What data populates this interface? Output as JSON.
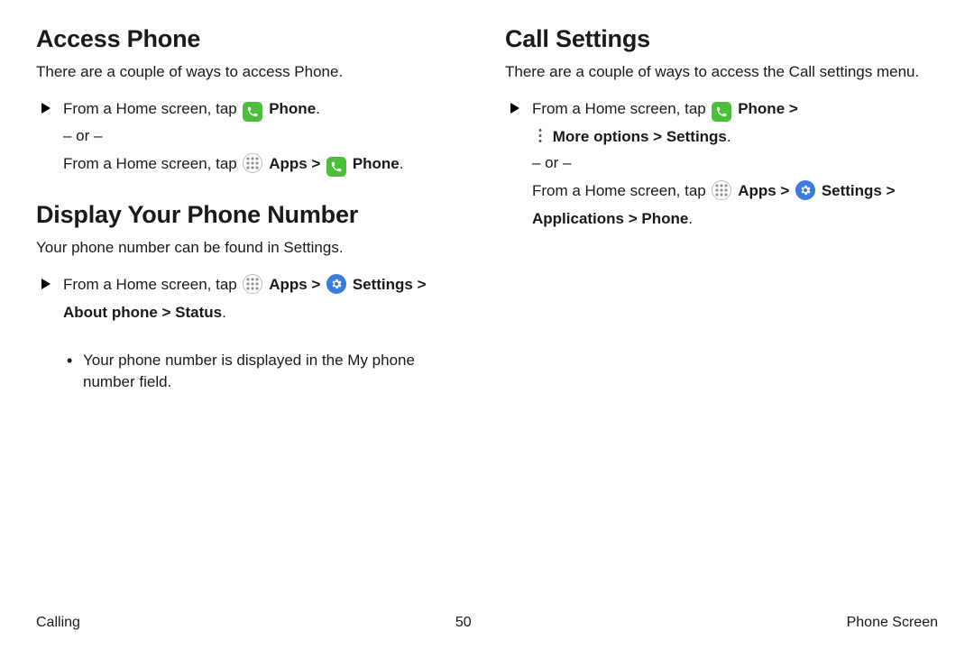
{
  "left": {
    "section1": {
      "heading": "Access Phone",
      "intro": "There are a couple of ways to access Phone.",
      "line1_pre": "From a Home screen, tap ",
      "phone_label": "Phone",
      "or": "– or –",
      "line2_pre": "From a Home screen, tap ",
      "apps_label": "Apps",
      "sep": " > ",
      "phone_label2": "Phone"
    },
    "section2": {
      "heading": "Display Your Phone Number",
      "intro": "Your phone number can be found in Settings.",
      "line1_pre": "From a Home screen, tap ",
      "apps_label": "Apps",
      "sep1": " > ",
      "settings_label": "Settings",
      "sep2": " > ",
      "path_rest": "About phone > Status",
      "bullet": "Your phone number is displayed in the My phone number field."
    }
  },
  "right": {
    "section1": {
      "heading": "Call Settings",
      "intro": "There are a couple of ways to access the Call settings menu.",
      "line1_pre": "From a Home screen, tap ",
      "phone_label": "Phone",
      "sep1": " > ",
      "more_path": "More options > Settings",
      "or": "– or –",
      "line2_pre": "From a Home screen, tap ",
      "apps_label": "Apps",
      "sep2": " > ",
      "settings_label": "Settings",
      "sep3": " > ",
      "path_rest": "Applications > Phone"
    }
  },
  "footer": {
    "left": "Calling",
    "center": "50",
    "right": "Phone Screen"
  },
  "strings": {
    "period": "."
  }
}
